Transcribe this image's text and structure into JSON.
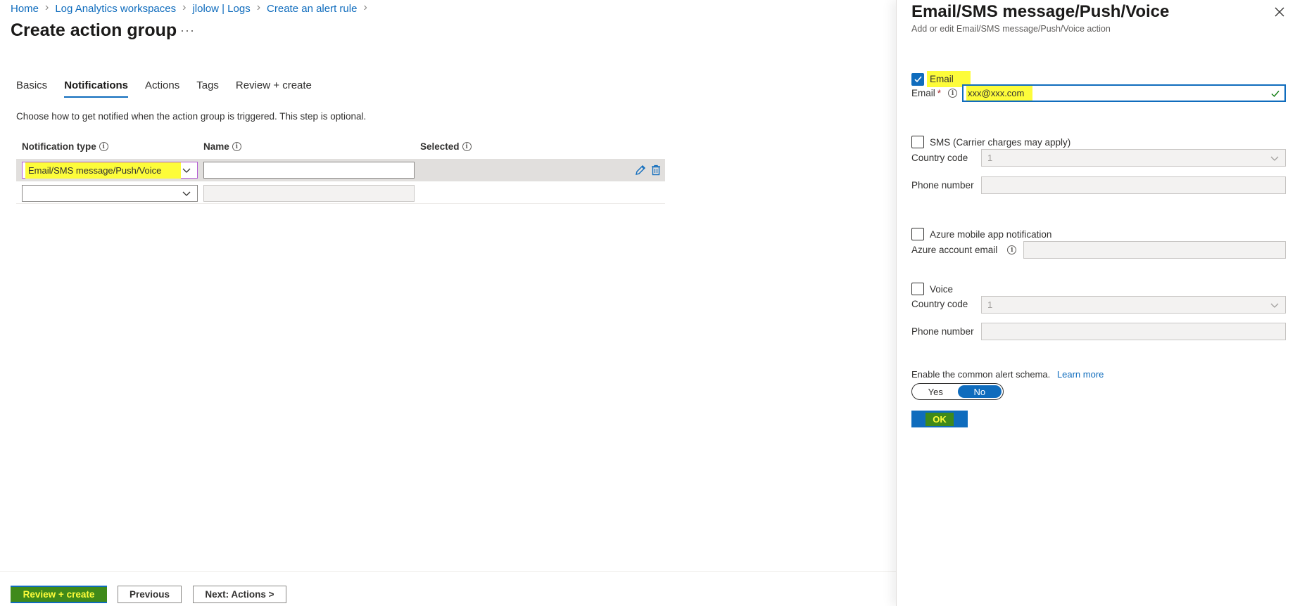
{
  "breadcrumb": {
    "items": [
      "Home",
      "Log Analytics workspaces",
      "jlolow | Logs",
      "Create an alert rule"
    ],
    "separator": "›"
  },
  "page": {
    "title": "Create action group",
    "more": "···"
  },
  "tabs": [
    {
      "label": "Basics",
      "active": false
    },
    {
      "label": "Notifications",
      "active": true
    },
    {
      "label": "Actions",
      "active": false
    },
    {
      "label": "Tags",
      "active": false
    },
    {
      "label": "Review + create",
      "active": false
    }
  ],
  "notifications": {
    "description": "Choose how to get notified when the action group is triggered. This step is optional.",
    "columns": {
      "type": "Notification type",
      "name": "Name",
      "selected": "Selected"
    },
    "rows": [
      {
        "type": "Email/SMS message/Push/Voice",
        "name": "",
        "selected": ""
      },
      {
        "type": "",
        "name": "",
        "selected": ""
      }
    ],
    "info_icon": "i"
  },
  "footer": {
    "review_create": "Review + create",
    "previous": "Previous",
    "next": "Next: Actions >"
  },
  "panel": {
    "title": "Email/SMS message/Push/Voice",
    "subtitle": "Add or edit Email/SMS message/Push/Voice action",
    "email": {
      "checkbox_label": "Email",
      "checked": true,
      "field_label": "Email",
      "required": "*",
      "value": "xxx@xxx.com"
    },
    "sms": {
      "checkbox_label": "SMS (Carrier charges may apply)",
      "checked": false,
      "country_label": "Country code",
      "country_value": "1",
      "phone_label": "Phone number",
      "phone_value": ""
    },
    "app": {
      "checkbox_label": "Azure mobile app notification",
      "checked": false,
      "email_label": "Azure account email",
      "email_value": ""
    },
    "voice": {
      "checkbox_label": "Voice",
      "checked": false,
      "country_label": "Country code",
      "country_value": "1",
      "phone_label": "Phone number",
      "phone_value": ""
    },
    "schema": {
      "label": "Enable the common alert schema.",
      "learn_more": "Learn more",
      "yes": "Yes",
      "no": "No",
      "selected": "No"
    },
    "ok": "OK"
  },
  "colors": {
    "accent": "#0f6cbd",
    "highlight_yellow": "#fdfc3a",
    "highlight_green": "#3f8a1a"
  }
}
